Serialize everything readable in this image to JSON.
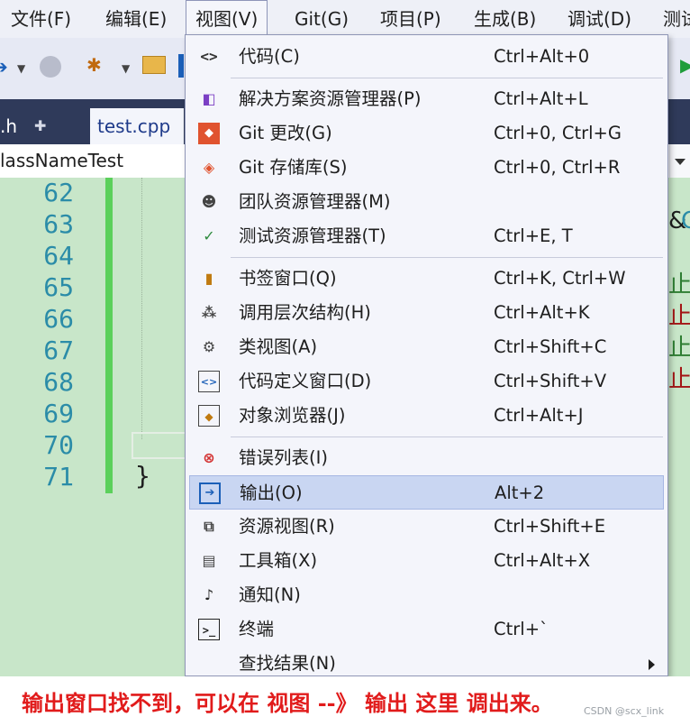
{
  "menubar": {
    "items": [
      "文件(F)",
      "编辑(E)",
      "视图(V)",
      "Git(G)",
      "项目(P)",
      "生成(B)",
      "调试(D)",
      "测试"
    ],
    "active_index": 2
  },
  "tabs": {
    "inactive_label": ".h",
    "pin_icon": "pin-icon",
    "active_label": "test.cpp"
  },
  "navbar": {
    "class_name": "lassNameTest"
  },
  "editor": {
    "line_numbers": [
      "62",
      "63",
      "64",
      "65",
      "66",
      "67",
      "68",
      "69",
      "70",
      "71"
    ],
    "closing_brace": "}",
    "right_text": [
      "&",
      "C",
      "止",
      "止",
      "止",
      "止"
    ],
    "colors": {
      "background": "#c8e6c9",
      "line_number": "#2b8ca8",
      "change_bar": "#5bd05b"
    }
  },
  "view_menu": {
    "items": [
      {
        "icon": "code-icon",
        "label": "代码(C)",
        "shortcut": "Ctrl+Alt+0"
      },
      {
        "icon": "solution-explorer-icon",
        "label": "解决方案资源管理器(P)",
        "shortcut": "Ctrl+Alt+L"
      },
      {
        "icon": "git-changes-icon",
        "label": "Git 更改(G)",
        "shortcut": "Ctrl+0, Ctrl+G"
      },
      {
        "icon": "git-repository-icon",
        "label": "Git 存储库(S)",
        "shortcut": "Ctrl+0, Ctrl+R"
      },
      {
        "icon": "team-explorer-icon",
        "label": "团队资源管理器(M)",
        "shortcut": ""
      },
      {
        "icon": "test-explorer-icon",
        "label": "测试资源管理器(T)",
        "shortcut": "Ctrl+E, T"
      },
      {
        "icon": "bookmark-window-icon",
        "label": "书签窗口(Q)",
        "shortcut": "Ctrl+K, Ctrl+W"
      },
      {
        "icon": "call-hierarchy-icon",
        "label": "调用层次结构(H)",
        "shortcut": "Ctrl+Alt+K"
      },
      {
        "icon": "class-view-icon",
        "label": "类视图(A)",
        "shortcut": "Ctrl+Shift+C"
      },
      {
        "icon": "code-definition-icon",
        "label": "代码定义窗口(D)",
        "shortcut": "Ctrl+Shift+V"
      },
      {
        "icon": "object-browser-icon",
        "label": "对象浏览器(J)",
        "shortcut": "Ctrl+Alt+J"
      },
      {
        "icon": "error-list-icon",
        "label": "错误列表(I)",
        "shortcut": ""
      },
      {
        "icon": "output-icon",
        "label": "输出(O)",
        "shortcut": "Alt+2"
      },
      {
        "icon": "resource-view-icon",
        "label": "资源视图(R)",
        "shortcut": "Ctrl+Shift+E"
      },
      {
        "icon": "toolbox-icon",
        "label": "工具箱(X)",
        "shortcut": "Ctrl+Alt+X"
      },
      {
        "icon": "notification-bell-icon",
        "label": "通知(N)",
        "shortcut": ""
      },
      {
        "icon": "terminal-icon",
        "label": "终端",
        "shortcut": "Ctrl+`"
      },
      {
        "icon": "",
        "label": "查找结果(N)",
        "shortcut": ""
      }
    ],
    "highlighted_index": 12,
    "colors": {
      "menu_bg": "#f4f5fb",
      "highlight": "#c9d6f2"
    }
  },
  "caption": {
    "text": "输出窗口找不到，可以在 视图 --》 输出 这里 调出来。",
    "color": "#e11b1b",
    "watermark": "CSDN @scx_link"
  }
}
